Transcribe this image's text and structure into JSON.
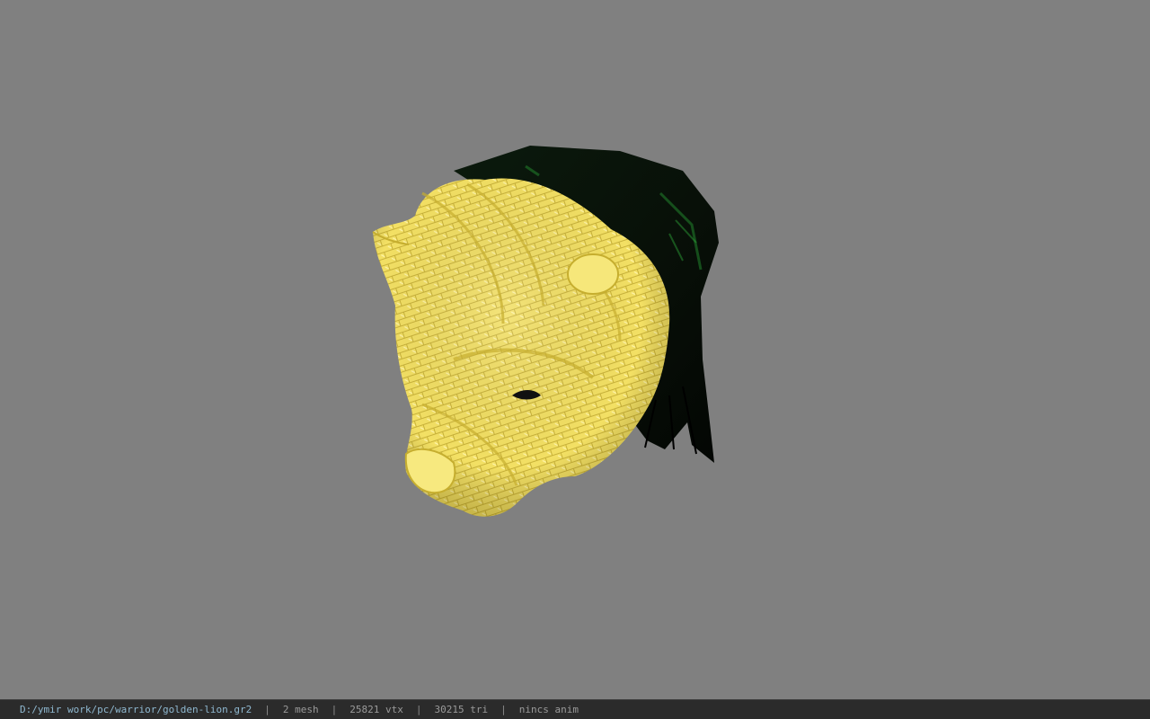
{
  "viewport": {
    "background_color": "#808080",
    "model": {
      "mesh_color": "#f2df5a",
      "hair_color": "#0a140a",
      "hair_highlight_color": "#1f7a2a"
    }
  },
  "status_bar": {
    "file_path": "D:/ymir work/pc/warrior/golden-lion.gr2",
    "separator": "|",
    "mesh_count": "2 mesh",
    "vertex_count": "25821 vtx",
    "triangle_count": "30215 tri",
    "anim_status": "nincs anim"
  }
}
